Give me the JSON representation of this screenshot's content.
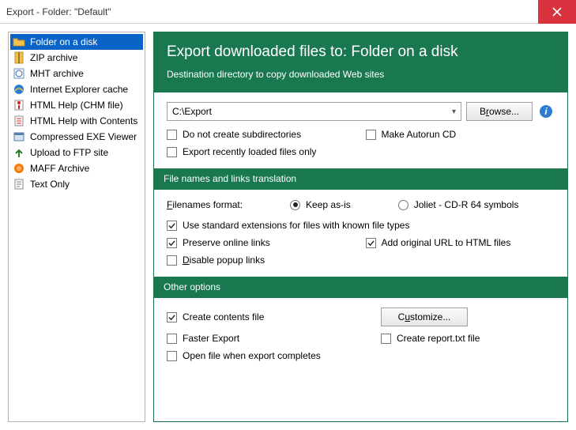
{
  "window": {
    "title": "Export - Folder: \"Default\""
  },
  "sidebar": {
    "items": [
      {
        "label": "Folder on a disk",
        "icon": "folder-open"
      },
      {
        "label": "ZIP archive",
        "icon": "zip"
      },
      {
        "label": "MHT archive",
        "icon": "mht"
      },
      {
        "label": "Internet Explorer cache",
        "icon": "ie"
      },
      {
        "label": "HTML Help (CHM file)",
        "icon": "chm"
      },
      {
        "label": "HTML Help with Contents",
        "icon": "chm-toc"
      },
      {
        "label": "Compressed EXE Viewer",
        "icon": "exe"
      },
      {
        "label": "Upload to FTP site",
        "icon": "ftp"
      },
      {
        "label": "MAFF Archive",
        "icon": "maff"
      },
      {
        "label": "Text Only",
        "icon": "text"
      }
    ],
    "selected_index": 0
  },
  "main": {
    "header": {
      "title": "Export downloaded files to: Folder on a disk",
      "subtitle": "Destination directory to copy downloaded Web sites"
    },
    "dest": {
      "path": "C:\\Export",
      "browse_label": "Browse...",
      "checks": {
        "no_subdirs_label": "Do not create subdirectories",
        "no_subdirs": false,
        "make_autorun_label": "Make Autorun CD",
        "make_autorun": false,
        "recent_only_label": "Export recently loaded files only",
        "recent_only": false
      }
    },
    "filenames": {
      "section_title": "File names and links translation",
      "format_label": "Filenames format:",
      "radios": {
        "keep_label": "Keep as-is",
        "keep": true,
        "joliet_label": "Joliet - CD-R 64 symbols",
        "joliet": false
      },
      "checks": {
        "std_ext_label": "Use standard extensions for files with known file types",
        "std_ext": true,
        "preserve_links_label": "Preserve online links",
        "preserve_links": true,
        "add_url_label": "Add original URL to HTML files",
        "add_url": true,
        "disable_popup_label": "Disable popup links",
        "disable_popup": false
      }
    },
    "other": {
      "section_title": "Other options",
      "checks": {
        "contents_label": "Create contents file",
        "contents": true,
        "customize_label": "Customize...",
        "faster_label": "Faster Export",
        "faster": false,
        "report_label": "Create report.txt file",
        "report": false,
        "open_after_label": "Open file when export completes",
        "open_after": false
      }
    }
  }
}
